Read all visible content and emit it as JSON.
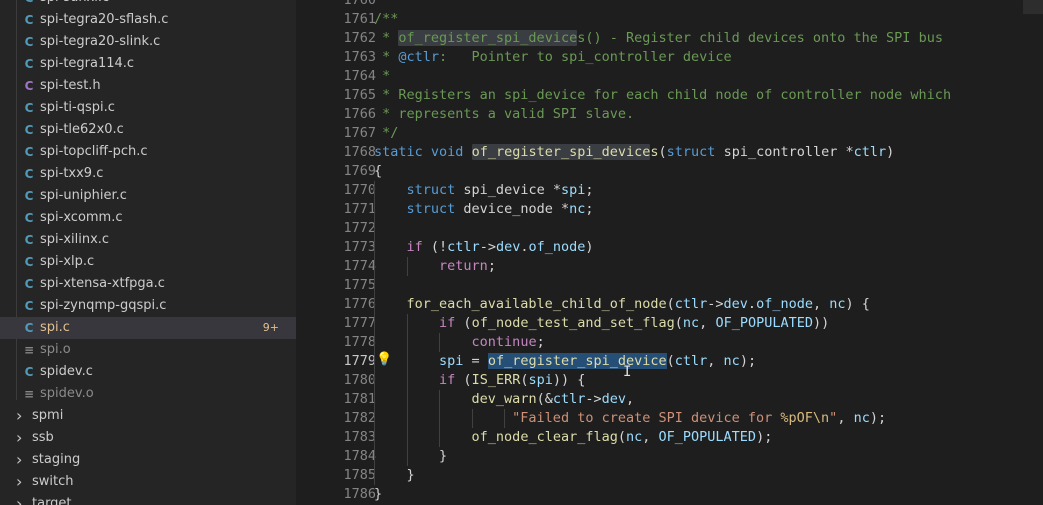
{
  "sidebar": {
    "files": [
      {
        "name": "spi-sunxi.c",
        "icon": "C",
        "color": "#519aba"
      },
      {
        "name": "spi-tegra20-sflash.c",
        "icon": "C",
        "color": "#519aba"
      },
      {
        "name": "spi-tegra20-slink.c",
        "icon": "C",
        "color": "#519aba"
      },
      {
        "name": "spi-tegra114.c",
        "icon": "C",
        "color": "#519aba"
      },
      {
        "name": "spi-test.h",
        "icon": "C",
        "color": "#a074c4"
      },
      {
        "name": "spi-ti-qspi.c",
        "icon": "C",
        "color": "#519aba"
      },
      {
        "name": "spi-tle62x0.c",
        "icon": "C",
        "color": "#519aba"
      },
      {
        "name": "spi-topcliff-pch.c",
        "icon": "C",
        "color": "#519aba"
      },
      {
        "name": "spi-txx9.c",
        "icon": "C",
        "color": "#519aba"
      },
      {
        "name": "spi-uniphier.c",
        "icon": "C",
        "color": "#519aba"
      },
      {
        "name": "spi-xcomm.c",
        "icon": "C",
        "color": "#519aba"
      },
      {
        "name": "spi-xilinx.c",
        "icon": "C",
        "color": "#519aba"
      },
      {
        "name": "spi-xlp.c",
        "icon": "C",
        "color": "#519aba"
      },
      {
        "name": "spi-xtensa-xtfpga.c",
        "icon": "C",
        "color": "#519aba"
      },
      {
        "name": "spi-zynqmp-gqspi.c",
        "icon": "C",
        "color": "#519aba"
      },
      {
        "name": "spi.c",
        "icon": "C",
        "color": "#519aba",
        "active": true,
        "badge": "9+",
        "text_color": "#e2c08d"
      },
      {
        "name": "spi.o",
        "icon": "≡",
        "color": "#858585",
        "text_color": "#8b8b8b"
      },
      {
        "name": "spidev.c",
        "icon": "C",
        "color": "#519aba"
      },
      {
        "name": "spidev.o",
        "icon": "≡",
        "color": "#858585",
        "text_color": "#8b8b8b"
      }
    ],
    "folders": [
      {
        "name": "spmi"
      },
      {
        "name": "ssb"
      },
      {
        "name": "staging"
      },
      {
        "name": "switch"
      },
      {
        "name": "target"
      }
    ]
  },
  "editor": {
    "top_line_partial": "1760",
    "current_line": "1779",
    "lines": [
      {
        "n": "1761",
        "tokens": [
          [
            "c",
            "/**"
          ]
        ]
      },
      {
        "n": "1762",
        "tokens": [
          [
            "c",
            " * "
          ],
          [
            "c hl-word",
            "of_register_spi_device"
          ],
          [
            "c",
            "s() - Register child devices onto the SPI bus"
          ]
        ]
      },
      {
        "n": "1763",
        "tokens": [
          [
            "c",
            " * "
          ],
          [
            "ck",
            "@ctlr"
          ],
          [
            "c",
            ":   Pointer to spi_controller device"
          ]
        ]
      },
      {
        "n": "1764",
        "tokens": [
          [
            "c",
            " *"
          ]
        ]
      },
      {
        "n": "1765",
        "tokens": [
          [
            "c",
            " * Registers an spi_device for each child node of controller node which"
          ]
        ]
      },
      {
        "n": "1766",
        "tokens": [
          [
            "c",
            " * represents a valid SPI slave."
          ]
        ]
      },
      {
        "n": "1767",
        "tokens": [
          [
            "c",
            " */"
          ]
        ]
      },
      {
        "n": "1768",
        "tokens": [
          [
            "kw",
            "static"
          ],
          [
            "",
            " "
          ],
          [
            "kw",
            "void"
          ],
          [
            "",
            " "
          ],
          [
            "fn hl-word",
            "of_register_spi_device"
          ],
          [
            "fn",
            "s"
          ],
          [
            "",
            "("
          ],
          [
            "kw",
            "struct"
          ],
          [
            "",
            " spi_controller *"
          ],
          [
            "v",
            "ctlr"
          ],
          [
            "",
            ")"
          ]
        ]
      },
      {
        "n": "1769",
        "tokens": [
          [
            "",
            "{"
          ]
        ]
      },
      {
        "n": "1770",
        "tokens": [
          [
            "",
            "    "
          ],
          [
            "kw",
            "struct"
          ],
          [
            "",
            " spi_device *"
          ],
          [
            "v",
            "spi"
          ],
          [
            "",
            ";"
          ]
        ]
      },
      {
        "n": "1771",
        "tokens": [
          [
            "",
            "    "
          ],
          [
            "kw",
            "struct"
          ],
          [
            "",
            " device_node *"
          ],
          [
            "v",
            "nc"
          ],
          [
            "",
            ";"
          ]
        ]
      },
      {
        "n": "1772",
        "tokens": [
          [
            "",
            ""
          ]
        ]
      },
      {
        "n": "1773",
        "tokens": [
          [
            "",
            "    "
          ],
          [
            "cf",
            "if"
          ],
          [
            "",
            " (!"
          ],
          [
            "v",
            "ctlr"
          ],
          [
            "",
            "->"
          ],
          [
            "v",
            "dev"
          ],
          [
            "",
            "."
          ],
          [
            "v",
            "of_node"
          ],
          [
            "",
            ")"
          ]
        ]
      },
      {
        "n": "1774",
        "tokens": [
          [
            "",
            "        "
          ],
          [
            "cf",
            "return"
          ],
          [
            "",
            ";"
          ]
        ]
      },
      {
        "n": "1775",
        "tokens": [
          [
            "",
            ""
          ]
        ]
      },
      {
        "n": "1776",
        "tokens": [
          [
            "",
            "    "
          ],
          [
            "fn",
            "for_each_available_child_of_node"
          ],
          [
            "",
            "("
          ],
          [
            "v",
            "ctlr"
          ],
          [
            "",
            "->"
          ],
          [
            "v",
            "dev"
          ],
          [
            "",
            "."
          ],
          [
            "v",
            "of_node"
          ],
          [
            "",
            ", "
          ],
          [
            "v",
            "nc"
          ],
          [
            "",
            ") {"
          ]
        ]
      },
      {
        "n": "1777",
        "tokens": [
          [
            "",
            "        "
          ],
          [
            "cf",
            "if"
          ],
          [
            "",
            " ("
          ],
          [
            "fn",
            "of_node_test_and_set_flag"
          ],
          [
            "",
            "("
          ],
          [
            "v",
            "nc"
          ],
          [
            "",
            ", "
          ],
          [
            "v",
            "OF_POPULATED"
          ],
          [
            "",
            "))"
          ]
        ]
      },
      {
        "n": "1778",
        "tokens": [
          [
            "",
            "            "
          ],
          [
            "cf",
            "continue"
          ],
          [
            "",
            ";"
          ]
        ]
      },
      {
        "n": "1779",
        "tokens": [
          [
            "",
            "        "
          ],
          [
            "v",
            "spi"
          ],
          [
            "",
            " = "
          ],
          [
            "fn hl-sel",
            "of_register_spi_device"
          ],
          [
            "",
            "("
          ],
          [
            "v",
            "ctlr"
          ],
          [
            "",
            ", "
          ],
          [
            "v",
            "nc"
          ],
          [
            "",
            ");"
          ]
        ]
      },
      {
        "n": "1780",
        "tokens": [
          [
            "",
            "        "
          ],
          [
            "cf",
            "if"
          ],
          [
            "",
            " ("
          ],
          [
            "mac",
            "IS_ERR"
          ],
          [
            "",
            "("
          ],
          [
            "v",
            "spi"
          ],
          [
            "",
            ")) {"
          ]
        ]
      },
      {
        "n": "1781",
        "tokens": [
          [
            "",
            "            "
          ],
          [
            "fn",
            "dev_warn"
          ],
          [
            "",
            "(&"
          ],
          [
            "v",
            "ctlr"
          ],
          [
            "",
            "->"
          ],
          [
            "v",
            "dev"
          ],
          [
            "",
            ","
          ]
        ]
      },
      {
        "n": "1782",
        "tokens": [
          [
            "",
            "                 "
          ],
          [
            "s",
            "\"Failed to create SPI device for "
          ],
          [
            "esc",
            "%pOF\\n"
          ],
          [
            "s",
            "\""
          ],
          [
            "",
            ", "
          ],
          [
            "v",
            "nc"
          ],
          [
            "",
            ");"
          ]
        ]
      },
      {
        "n": "1783",
        "tokens": [
          [
            "",
            "            "
          ],
          [
            "fn",
            "of_node_clear_flag"
          ],
          [
            "",
            "("
          ],
          [
            "v",
            "nc"
          ],
          [
            "",
            ", "
          ],
          [
            "v",
            "OF_POPULATED"
          ],
          [
            "",
            ");"
          ]
        ]
      },
      {
        "n": "1784",
        "tokens": [
          [
            "",
            "        }"
          ]
        ]
      },
      {
        "n": "1785",
        "tokens": [
          [
            "",
            "    }"
          ]
        ]
      },
      {
        "n": "1786",
        "tokens": [
          [
            "",
            "}"
          ]
        ]
      }
    ]
  }
}
